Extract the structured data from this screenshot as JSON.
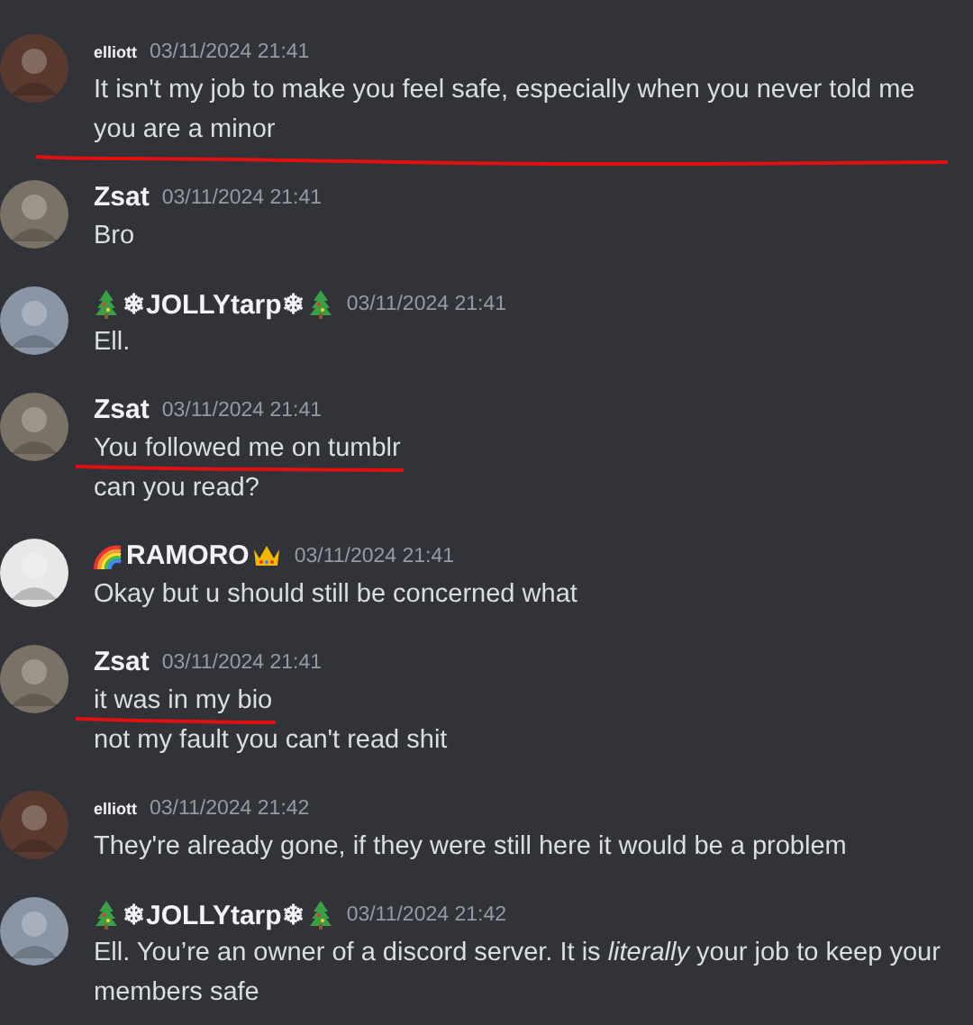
{
  "messages": [
    {
      "author": "elliott",
      "compact_name": true,
      "color": "#5a3a2e",
      "timestamp": "03/11/2024 21:41",
      "lines": [
        {
          "text": "It isn't my job to make you feel safe, especially when you never told me you are a minor",
          "kind": "underlined-wide"
        }
      ]
    },
    {
      "author": "Zsat",
      "compact_name": false,
      "color": "#7a7266",
      "timestamp": "03/11/2024 21:41",
      "lines": [
        {
          "text": "Bro",
          "kind": "plain"
        }
      ]
    },
    {
      "author": "❄JOLLYtarp❄",
      "compact_name": false,
      "decor_before": [
        {
          "kind": "tree"
        }
      ],
      "decor_after": [
        {
          "kind": "tree"
        }
      ],
      "color": "#8a96a6",
      "timestamp": "03/11/2024 21:41",
      "lines": [
        {
          "text": "Ell.",
          "kind": "plain"
        }
      ]
    },
    {
      "author": "Zsat",
      "compact_name": false,
      "color": "#7a7266",
      "timestamp": "03/11/2024 21:41",
      "lines": [
        {
          "text": "You followed me on tumblr",
          "kind": "underlined"
        },
        {
          "text": "can you read?",
          "kind": "plain"
        }
      ]
    },
    {
      "author": "RAMORO",
      "compact_name": false,
      "decor_before": [
        {
          "kind": "rainbow"
        }
      ],
      "decor_after": [
        {
          "kind": "crown"
        }
      ],
      "color": "#e8e8e8",
      "timestamp": "03/11/2024 21:41",
      "lines": [
        {
          "text": "Okay but u should still be concerned what",
          "kind": "plain"
        }
      ]
    },
    {
      "author": "Zsat",
      "compact_name": false,
      "color": "#7a7266",
      "timestamp": "03/11/2024 21:41",
      "lines": [
        {
          "text": "it was in my bio",
          "kind": "underlined"
        },
        {
          "text": "not my fault you can't read shit",
          "kind": "plain"
        }
      ]
    },
    {
      "author": "elliott",
      "compact_name": true,
      "color": "#5a3a2e",
      "timestamp": "03/11/2024 21:42",
      "lines": [
        {
          "text": "They're already gone, if they were still here it would be a problem",
          "kind": "plain"
        }
      ]
    },
    {
      "author": "❄JOLLYtarp❄",
      "compact_name": false,
      "decor_before": [
        {
          "kind": "tree"
        }
      ],
      "decor_after": [
        {
          "kind": "tree"
        }
      ],
      "color": "#8a96a6",
      "timestamp": "03/11/2024 21:42",
      "lines": [
        {
          "text": "Ell. You’re an owner of a discord server. It is *literally* your job to keep your members safe",
          "kind": "plain"
        }
      ]
    }
  ]
}
